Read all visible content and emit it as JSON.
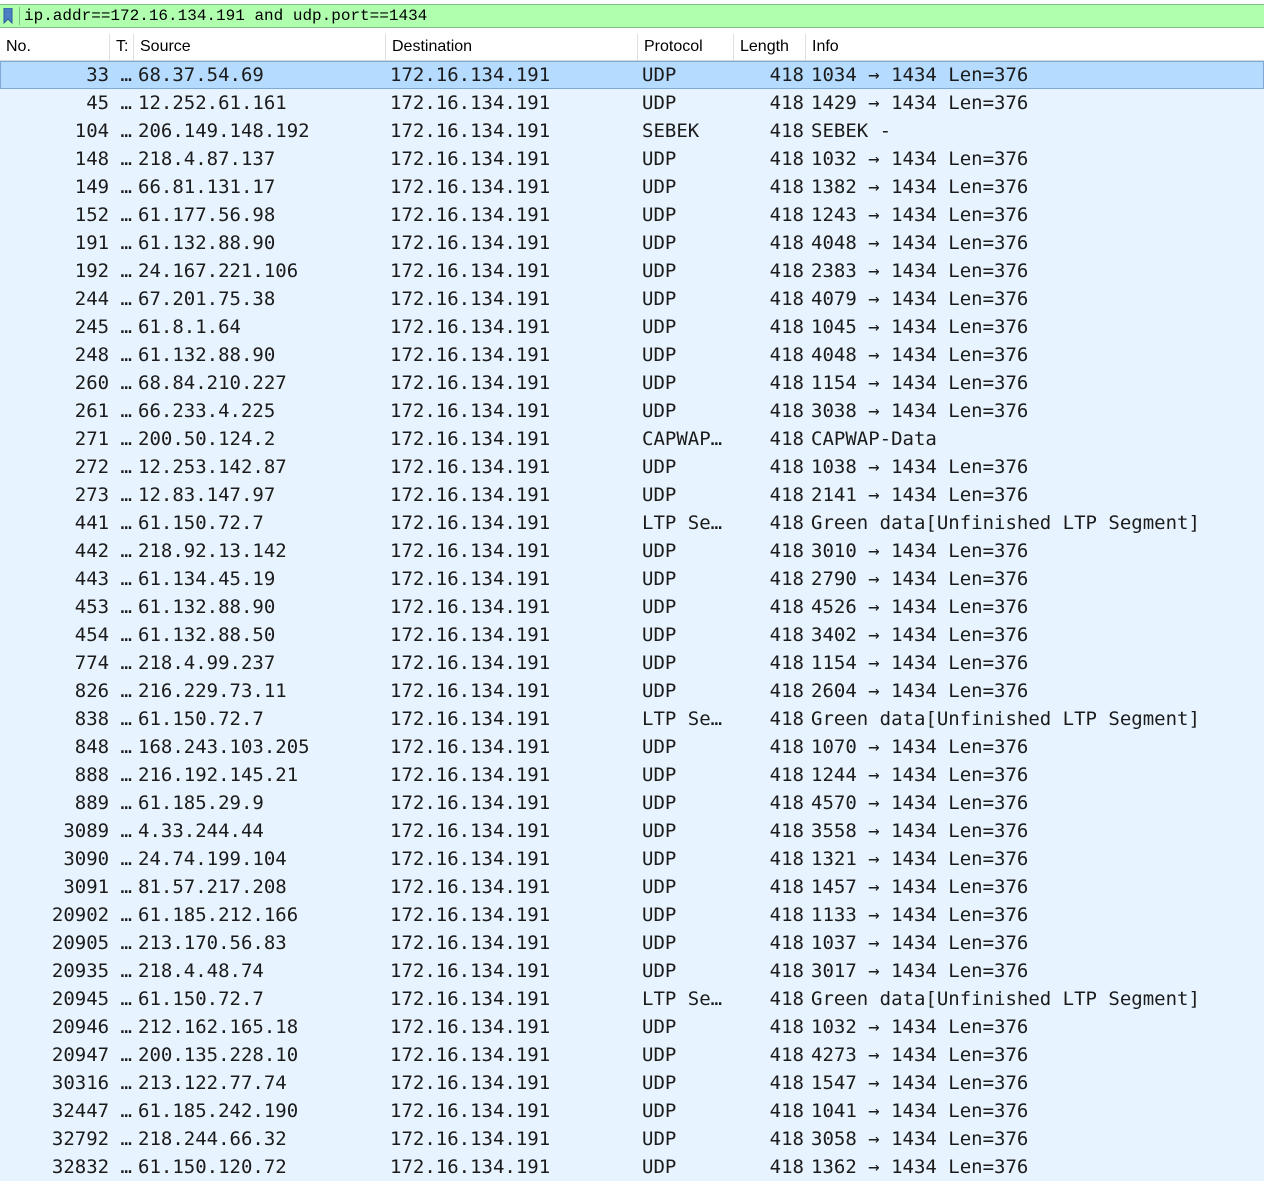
{
  "filter": {
    "text": "ip.addr==172.16.134.191 and udp.port==1434"
  },
  "columns": {
    "no": "No.",
    "time": "T:",
    "source": "Source",
    "destination": "Destination",
    "protocol": "Protocol",
    "length": "Length",
    "info": "Info"
  },
  "packets": [
    {
      "no": "33 …",
      "src": "68.37.54.69",
      "dst": "172.16.134.191",
      "proto": "UDP",
      "len": "418",
      "info": "1034 → 1434  Len=376",
      "selected": true
    },
    {
      "no": "45 …",
      "src": "12.252.61.161",
      "dst": "172.16.134.191",
      "proto": "UDP",
      "len": "418",
      "info": "1429 → 1434  Len=376"
    },
    {
      "no": "104 …",
      "src": "206.149.148.192",
      "dst": "172.16.134.191",
      "proto": "SEBEK",
      "len": "418",
      "info": "SEBEK -"
    },
    {
      "no": "148 …",
      "src": "218.4.87.137",
      "dst": "172.16.134.191",
      "proto": "UDP",
      "len": "418",
      "info": "1032 → 1434  Len=376"
    },
    {
      "no": "149 …",
      "src": "66.81.131.17",
      "dst": "172.16.134.191",
      "proto": "UDP",
      "len": "418",
      "info": "1382 → 1434  Len=376"
    },
    {
      "no": "152 …",
      "src": "61.177.56.98",
      "dst": "172.16.134.191",
      "proto": "UDP",
      "len": "418",
      "info": "1243 → 1434  Len=376"
    },
    {
      "no": "191 …",
      "src": "61.132.88.90",
      "dst": "172.16.134.191",
      "proto": "UDP",
      "len": "418",
      "info": "4048 → 1434  Len=376"
    },
    {
      "no": "192 …",
      "src": "24.167.221.106",
      "dst": "172.16.134.191",
      "proto": "UDP",
      "len": "418",
      "info": "2383 → 1434  Len=376"
    },
    {
      "no": "244 …",
      "src": "67.201.75.38",
      "dst": "172.16.134.191",
      "proto": "UDP",
      "len": "418",
      "info": "4079 → 1434  Len=376"
    },
    {
      "no": "245 …",
      "src": "61.8.1.64",
      "dst": "172.16.134.191",
      "proto": "UDP",
      "len": "418",
      "info": "1045 → 1434  Len=376"
    },
    {
      "no": "248 …",
      "src": "61.132.88.90",
      "dst": "172.16.134.191",
      "proto": "UDP",
      "len": "418",
      "info": "4048 → 1434  Len=376"
    },
    {
      "no": "260 …",
      "src": "68.84.210.227",
      "dst": "172.16.134.191",
      "proto": "UDP",
      "len": "418",
      "info": "1154 → 1434  Len=376"
    },
    {
      "no": "261 …",
      "src": "66.233.4.225",
      "dst": "172.16.134.191",
      "proto": "UDP",
      "len": "418",
      "info": "3038 → 1434  Len=376"
    },
    {
      "no": "271 …",
      "src": "200.50.124.2",
      "dst": "172.16.134.191",
      "proto": "CAPWAP…",
      "len": "418",
      "info": "CAPWAP-Data"
    },
    {
      "no": "272 …",
      "src": "12.253.142.87",
      "dst": "172.16.134.191",
      "proto": "UDP",
      "len": "418",
      "info": "1038 → 1434  Len=376"
    },
    {
      "no": "273 …",
      "src": "12.83.147.97",
      "dst": "172.16.134.191",
      "proto": "UDP",
      "len": "418",
      "info": "2141 → 1434  Len=376"
    },
    {
      "no": "441 …",
      "src": "61.150.72.7",
      "dst": "172.16.134.191",
      "proto": "LTP Se…",
      "len": "418",
      "info": "Green data[Unfinished LTP Segment]"
    },
    {
      "no": "442 …",
      "src": "218.92.13.142",
      "dst": "172.16.134.191",
      "proto": "UDP",
      "len": "418",
      "info": "3010 → 1434  Len=376"
    },
    {
      "no": "443 …",
      "src": "61.134.45.19",
      "dst": "172.16.134.191",
      "proto": "UDP",
      "len": "418",
      "info": "2790 → 1434  Len=376"
    },
    {
      "no": "453 …",
      "src": "61.132.88.90",
      "dst": "172.16.134.191",
      "proto": "UDP",
      "len": "418",
      "info": "4526 → 1434  Len=376"
    },
    {
      "no": "454 …",
      "src": "61.132.88.50",
      "dst": "172.16.134.191",
      "proto": "UDP",
      "len": "418",
      "info": "3402 → 1434  Len=376"
    },
    {
      "no": "774 …",
      "src": "218.4.99.237",
      "dst": "172.16.134.191",
      "proto": "UDP",
      "len": "418",
      "info": "1154 → 1434  Len=376"
    },
    {
      "no": "826 …",
      "src": "216.229.73.11",
      "dst": "172.16.134.191",
      "proto": "UDP",
      "len": "418",
      "info": "2604 → 1434  Len=376"
    },
    {
      "no": "838 …",
      "src": "61.150.72.7",
      "dst": "172.16.134.191",
      "proto": "LTP Se…",
      "len": "418",
      "info": "Green data[Unfinished LTP Segment]"
    },
    {
      "no": "848 …",
      "src": "168.243.103.205",
      "dst": "172.16.134.191",
      "proto": "UDP",
      "len": "418",
      "info": "1070 → 1434  Len=376"
    },
    {
      "no": "888 …",
      "src": "216.192.145.21",
      "dst": "172.16.134.191",
      "proto": "UDP",
      "len": "418",
      "info": "1244 → 1434  Len=376"
    },
    {
      "no": "889 …",
      "src": "61.185.29.9",
      "dst": "172.16.134.191",
      "proto": "UDP",
      "len": "418",
      "info": "4570 → 1434  Len=376"
    },
    {
      "no": "3089 …",
      "src": "4.33.244.44",
      "dst": "172.16.134.191",
      "proto": "UDP",
      "len": "418",
      "info": "3558 → 1434  Len=376"
    },
    {
      "no": "3090 …",
      "src": "24.74.199.104",
      "dst": "172.16.134.191",
      "proto": "UDP",
      "len": "418",
      "info": "1321 → 1434  Len=376"
    },
    {
      "no": "3091 …",
      "src": "81.57.217.208",
      "dst": "172.16.134.191",
      "proto": "UDP",
      "len": "418",
      "info": "1457 → 1434  Len=376"
    },
    {
      "no": "20902 …",
      "src": "61.185.212.166",
      "dst": "172.16.134.191",
      "proto": "UDP",
      "len": "418",
      "info": "1133 → 1434  Len=376"
    },
    {
      "no": "20905 …",
      "src": "213.170.56.83",
      "dst": "172.16.134.191",
      "proto": "UDP",
      "len": "418",
      "info": "1037 → 1434  Len=376"
    },
    {
      "no": "20935 …",
      "src": "218.4.48.74",
      "dst": "172.16.134.191",
      "proto": "UDP",
      "len": "418",
      "info": "3017 → 1434  Len=376"
    },
    {
      "no": "20945 …",
      "src": "61.150.72.7",
      "dst": "172.16.134.191",
      "proto": "LTP Se…",
      "len": "418",
      "info": "Green data[Unfinished LTP Segment]"
    },
    {
      "no": "20946 …",
      "src": "212.162.165.18",
      "dst": "172.16.134.191",
      "proto": "UDP",
      "len": "418",
      "info": "1032 → 1434  Len=376"
    },
    {
      "no": "20947 …",
      "src": "200.135.228.10",
      "dst": "172.16.134.191",
      "proto": "UDP",
      "len": "418",
      "info": "4273 → 1434  Len=376"
    },
    {
      "no": "30316 …",
      "src": "213.122.77.74",
      "dst": "172.16.134.191",
      "proto": "UDP",
      "len": "418",
      "info": "1547 → 1434  Len=376"
    },
    {
      "no": "32447 …",
      "src": "61.185.242.190",
      "dst": "172.16.134.191",
      "proto": "UDP",
      "len": "418",
      "info": "1041 → 1434  Len=376"
    },
    {
      "no": "32792 …",
      "src": "218.244.66.32",
      "dst": "172.16.134.191",
      "proto": "UDP",
      "len": "418",
      "info": "3058 → 1434  Len=376"
    },
    {
      "no": "32832 …",
      "src": "61.150.120.72",
      "dst": "172.16.134.191",
      "proto": "UDP",
      "len": "418",
      "info": "1362 → 1434  Len=376"
    }
  ]
}
